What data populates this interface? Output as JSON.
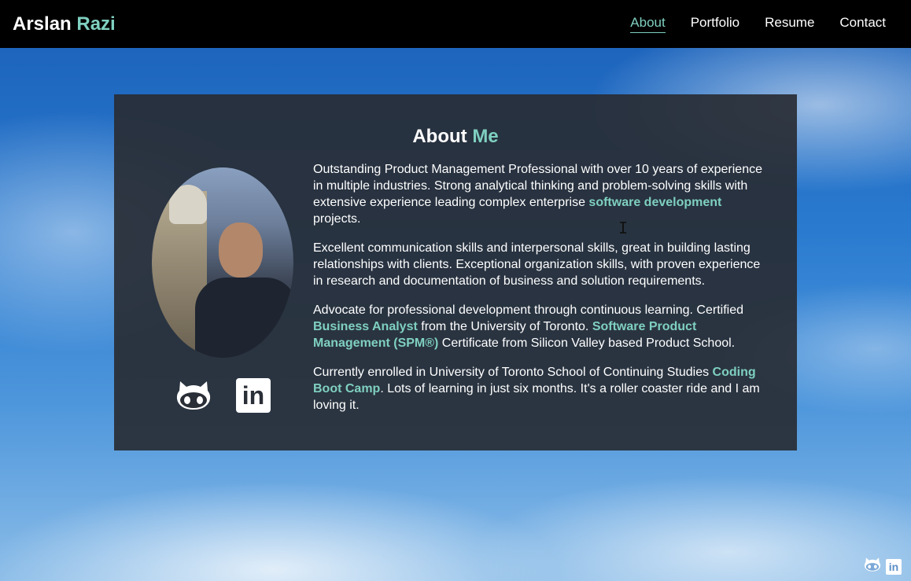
{
  "header": {
    "brand_first": "Arslan",
    "brand_last": "Razi",
    "nav": [
      {
        "label": "About",
        "active": true
      },
      {
        "label": "Portfolio",
        "active": false
      },
      {
        "label": "Resume",
        "active": false
      },
      {
        "label": "Contact",
        "active": false
      }
    ]
  },
  "about": {
    "title_first": "About",
    "title_last": "Me",
    "p1_a": "Outstanding Product Management Professional with over 10 years of experience in multiple industries. Strong analytical thinking and problem-solving skills with extensive experience leading complex enterprise ",
    "p1_hl": "software development",
    "p1_b": " projects.",
    "p2": "Excellent communication skills and interpersonal skills, great in building lasting relationships with clients. Exceptional organization skills, with proven experience in research and documentation of business and solution requirements.",
    "p3_a": "Advocate for professional development through continuous learning. Certified ",
    "p3_hl1": "Business Analyst",
    "p3_b": " from the University of Toronto. ",
    "p3_hl2": "Software Product Management (SPM®)",
    "p3_c": " Certificate from Silicon Valley based Product School.",
    "p4_a": "Currently enrolled in University of Toronto School of Continuing Studies ",
    "p4_hl": "Coding Boot Camp",
    "p4_b": ". Lots of learning in just six months. It's a roller coaster ride and I am loving it."
  },
  "icons": {
    "github": "github-icon",
    "linkedin": "linkedin-icon",
    "linkedin_glyph": "in"
  },
  "colors": {
    "accent": "#7fd0c0",
    "navbar": "#000000",
    "card": "#282c34"
  }
}
